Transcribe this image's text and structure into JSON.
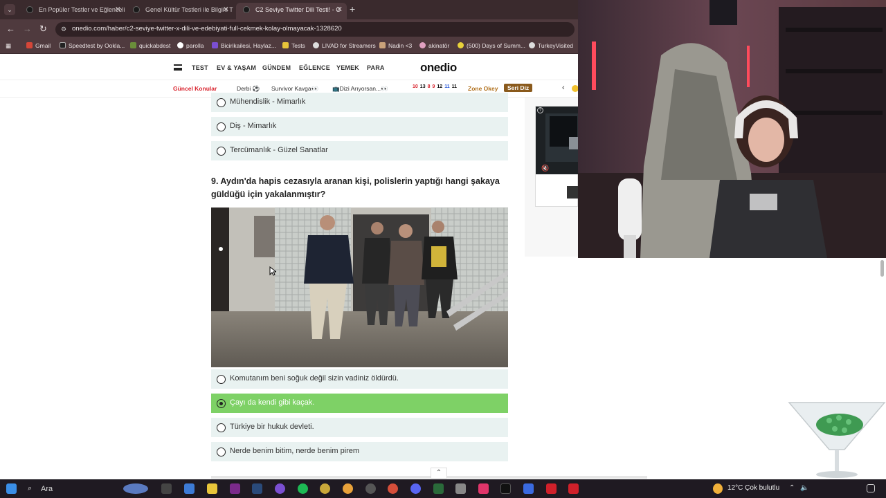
{
  "browser": {
    "tabs": [
      {
        "title": "En Popüler Testler ve Eğlenceli",
        "active": false
      },
      {
        "title": "Genel Kültür Testleri ile Bilgini T",
        "active": false
      },
      {
        "title": "C2 Seviye Twitter Dili Testi! - O",
        "active": true
      }
    ],
    "url": "onedio.com/haber/c2-seviye-twitter-x-dili-ve-edebiyati-full-cekmek-kolay-olmayacak-1328620",
    "bookmarks": [
      "Gmail",
      "Speedtest by Ookla...",
      "quickabdest",
      "parolla",
      "Bicirikailesi, Haylaz...",
      "Tests",
      "LIVAD for Streamers",
      "Nadin <3",
      "akinatör",
      "(500) Days of Summ...",
      "TurkeyVisited"
    ]
  },
  "site": {
    "logo": "onedio",
    "nav": [
      "TEST",
      "EV & YAŞAM",
      "GÜNDEM",
      "EĞLENCE",
      "YEMEK",
      "PARA"
    ],
    "topics_label": "Güncel Konular",
    "topics": [
      "Derbi ⚽",
      "Survivor Kavga👀",
      "📺Dizi Arıyorsan...👀"
    ],
    "numbers": [
      "10",
      "13",
      "8",
      "9",
      "12",
      "11",
      "11"
    ],
    "zone": "Zone Okey",
    "tag": "Seri Diz"
  },
  "quiz": {
    "prev_options": [
      "Mühendislik - Mimarlık",
      "Diş - Mimarlık",
      "Tercümanlık - Güzel Sanatlar"
    ],
    "question": "9. Aydın'da hapis cezasıyla aranan kişi, polislerin yaptığı hangi şakaya güldüğü için yakalanmıştır?",
    "options": [
      {
        "label": "Komutanım beni soğuk değil sizin vadiniz öldürdü.",
        "selected": false
      },
      {
        "label": "Çayı da kendi gibi kaçak.",
        "selected": true
      },
      {
        "label": "Türkiye bir hukuk devleti.",
        "selected": false
      },
      {
        "label": "Nerde benim bitim, nerde benim pirem",
        "selected": false
      }
    ]
  },
  "taskbar": {
    "search": "Ara",
    "weather": "12°C  Çok bulutlu"
  }
}
